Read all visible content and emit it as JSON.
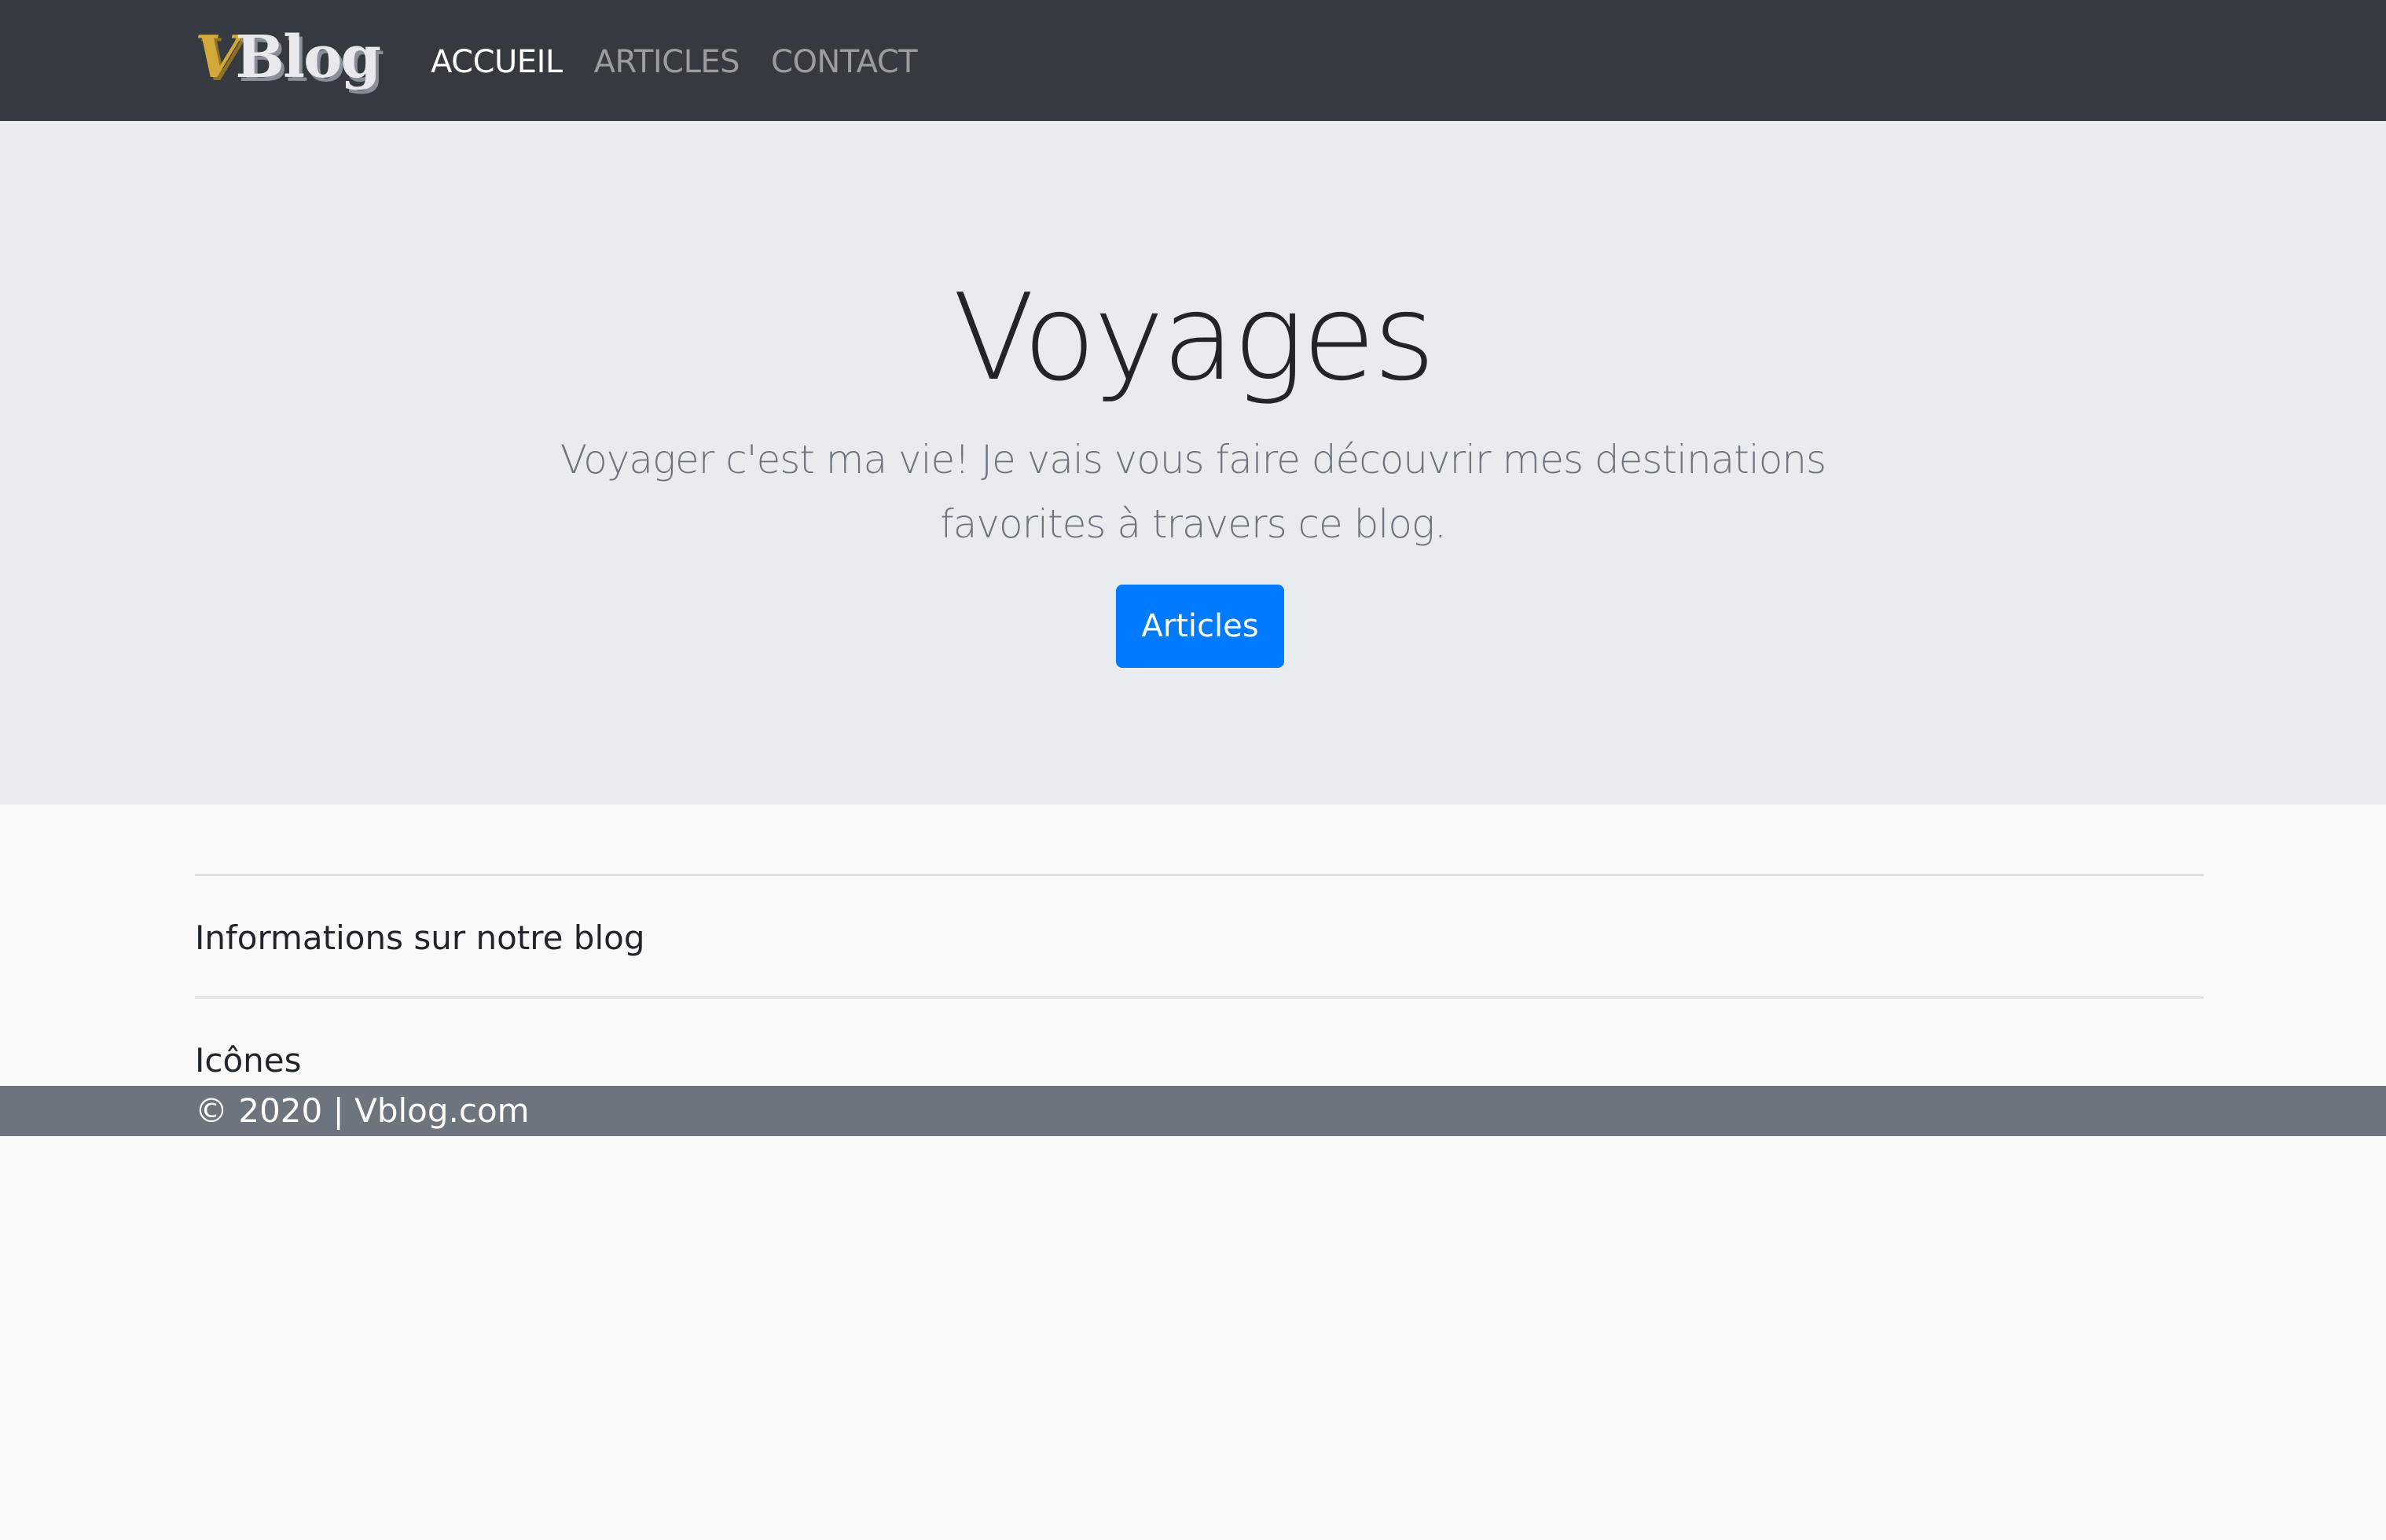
{
  "navbar": {
    "brand": {
      "logo_v": "V",
      "logo_text": "Blog"
    },
    "links": [
      {
        "label": "ACCUEIL",
        "active": true
      },
      {
        "label": "ARTICLES",
        "active": false
      },
      {
        "label": "CONTACT",
        "active": false
      }
    ]
  },
  "hero": {
    "title": "Voyages",
    "lead": "Voyager c'est ma vie! Je vais vous faire découvrir mes destinations favorites à travers ce blog.",
    "button_label": "Articles"
  },
  "content": {
    "info_heading": "Informations sur notre blog",
    "icons_heading": "Icônes"
  },
  "footer": {
    "copyright": "© 2020 | Vblog.com"
  },
  "colors": {
    "navbar_bg": "#343a40",
    "hero_bg": "#e9ecef",
    "page_bg": "#f9f9f9",
    "primary_button": "#007bff",
    "footer_bg": "#6c757d",
    "brand_gold": "#d2a83a"
  }
}
